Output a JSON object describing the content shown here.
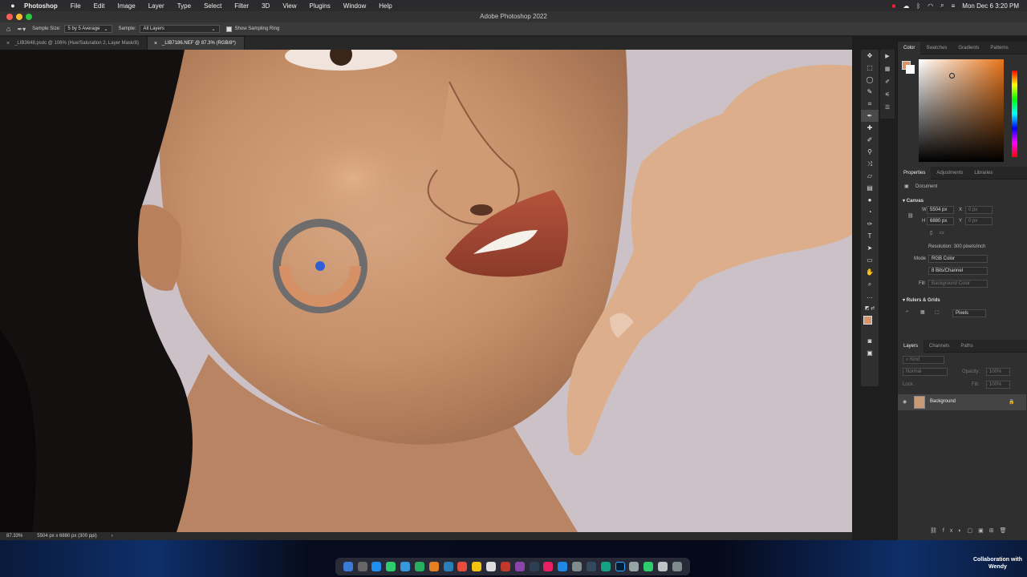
{
  "menubar": {
    "apple": "",
    "items": [
      "Photoshop",
      "File",
      "Edit",
      "Image",
      "Layer",
      "Type",
      "Select",
      "Filter",
      "3D",
      "View",
      "Plugins",
      "Window",
      "Help"
    ],
    "clock": "Mon Dec 6  3:20 PM"
  },
  "window": {
    "title": "Adobe Photoshop 2022"
  },
  "options": {
    "sample_size_label": "Sample Size:",
    "sample_size_value": "5 by 5 Average",
    "sample_label": "Sample:",
    "sample_value": "All Layers",
    "sampling_ring_label": "Show Sampling Ring"
  },
  "tabs": [
    {
      "label": "_LIB3648.psdc @ 106% (Hue/Saturation 2, Layer Mask/8)"
    },
    {
      "label": "_LIB7186.NEF @ 87.3% (RGB/8*)"
    }
  ],
  "status": {
    "zoom": "87.33%",
    "doc_info": "5504 px x 6880 px (300 ppi)",
    "arrow": "›"
  },
  "color_panel": {
    "tabs": [
      "Color",
      "Swatches",
      "Gradients",
      "Patterns"
    ],
    "foreground": "#d9956a"
  },
  "properties_panel": {
    "tabs": [
      "Properties",
      "Adjustments",
      "Libraries"
    ],
    "doc_label": "Document",
    "canvas_label": "Canvas",
    "w_label": "W",
    "w_value": "5504 px",
    "x_label": "X",
    "x_value": "0 px",
    "h_label": "H",
    "h_value": "6880 px",
    "y_label": "Y",
    "y_value": "0 px",
    "resolution": "Resolution: 300 pixels/inch",
    "mode_label": "Mode",
    "mode_value": "RGB Color",
    "bits_value": "8 Bits/Channel",
    "fill_label": "Fill",
    "fill_value": "Background Color",
    "rulers_label": "Rulers & Grids",
    "units_value": "Pixels"
  },
  "layers_panel": {
    "tabs": [
      "Layers",
      "Channels",
      "Paths"
    ],
    "kind": "Kind",
    "blend": "Normal",
    "opacity_label": "Opacity:",
    "opacity_value": "100%",
    "lock_label": "Lock:",
    "fill_label": "Fill:",
    "fill_value": "100%",
    "layer_name": "Background"
  },
  "desktop": {
    "collab_line1": "Collaboration with",
    "collab_line2": "Wendy"
  }
}
